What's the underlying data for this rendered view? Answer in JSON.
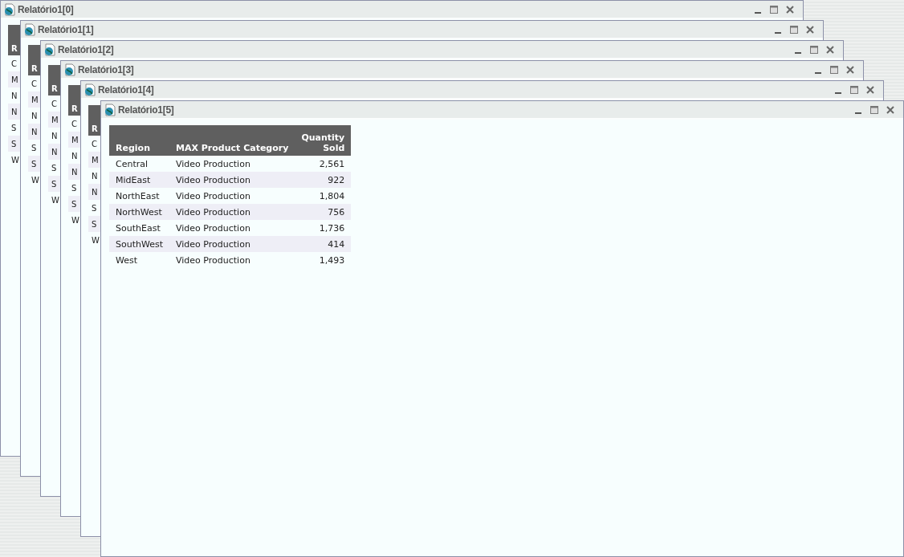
{
  "windows": [
    {
      "title": "Relatório1[0]",
      "table": {
        "columns": [
          "R"
        ],
        "rows": [
          [
            "C"
          ],
          [
            "M"
          ],
          [
            "N"
          ],
          [
            "N"
          ],
          [
            "S"
          ],
          [
            "S"
          ],
          [
            "W"
          ]
        ]
      }
    },
    {
      "title": "Relatório1[1]",
      "table": {
        "columns": [
          "R"
        ],
        "rows": [
          [
            "C"
          ],
          [
            "M"
          ],
          [
            "N"
          ],
          [
            "N"
          ],
          [
            "S"
          ],
          [
            "S"
          ],
          [
            "W"
          ]
        ]
      }
    },
    {
      "title": "Relatório1[2]",
      "table": {
        "columns": [
          "R"
        ],
        "rows": [
          [
            "C"
          ],
          [
            "M"
          ],
          [
            "N"
          ],
          [
            "N"
          ],
          [
            "S"
          ],
          [
            "S"
          ],
          [
            "W"
          ]
        ]
      }
    },
    {
      "title": "Relatório1[3]",
      "table": {
        "columns": [
          "R"
        ],
        "rows": [
          [
            "C"
          ],
          [
            "M"
          ],
          [
            "N"
          ],
          [
            "N"
          ],
          [
            "S"
          ],
          [
            "S"
          ],
          [
            "W"
          ]
        ]
      }
    },
    {
      "title": "Relatório1[4]",
      "table": {
        "columns": [
          "R"
        ],
        "rows": [
          [
            "C"
          ],
          [
            "M"
          ],
          [
            "N"
          ],
          [
            "N"
          ],
          [
            "S"
          ],
          [
            "S"
          ],
          [
            "W"
          ]
        ]
      }
    },
    {
      "title": "Relatório1[5]",
      "table": {
        "columns": [
          "Region",
          "MAX Product Category",
          "Quantity Sold"
        ],
        "rows": [
          [
            "Central",
            "Video Production",
            "2,561"
          ],
          [
            "MidEast",
            "Video Production",
            "922"
          ],
          [
            "NorthEast",
            "Video Production",
            "1,804"
          ],
          [
            "NorthWest",
            "Video Production",
            "756"
          ],
          [
            "SouthEast",
            "Video Production",
            "1,736"
          ],
          [
            "SouthWest",
            "Video Production",
            "414"
          ],
          [
            "West",
            "Video Production",
            "1,493"
          ]
        ]
      }
    }
  ]
}
